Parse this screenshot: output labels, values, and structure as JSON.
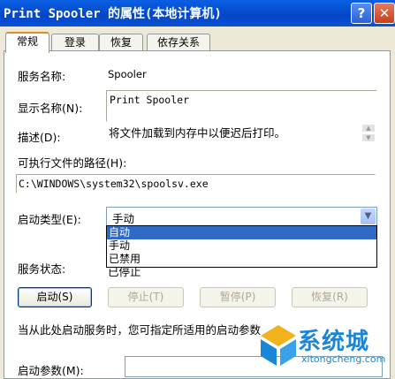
{
  "window": {
    "title": "Print Spooler 的属性(本地计算机)",
    "help_glyph": "?",
    "close_glyph": "✕"
  },
  "tabs": [
    {
      "label": "常规",
      "active": true
    },
    {
      "label": "登录"
    },
    {
      "label": "恢复"
    },
    {
      "label": "依存关系"
    }
  ],
  "general": {
    "service_name_label": "服务名称:",
    "service_name_value": "Spooler",
    "display_name_label": "显示名称(N):",
    "display_name_value": "Print Spooler",
    "description_label": "描述(D):",
    "description_value": "将文件加载到内存中以便迟后打印。",
    "exe_path_label": "可执行文件的路径(H):",
    "exe_path_value": "C:\\WINDOWS\\system32\\spoolsv.exe",
    "startup_type_label": "启动类型(E):",
    "startup_type_value": "手动",
    "startup_type_options": [
      "自动",
      "手动",
      "已禁用"
    ],
    "service_status_label": "服务状态:",
    "service_status_value": "已停止",
    "buttons": {
      "start": "启动(S)",
      "stop": "停止(T)",
      "pause": "暂停(P)",
      "resume": "恢复(R)"
    },
    "hint_text": "当从此处启动服务时，您可指定所适用的启动参数",
    "start_params_label": "启动参数(M):"
  },
  "watermark": {
    "text": "系统城",
    "url": "xitongcheng.com"
  },
  "colors": {
    "title_bar": "#0446c6",
    "selection": "#316ac5",
    "watermark": "#1a86d6"
  }
}
